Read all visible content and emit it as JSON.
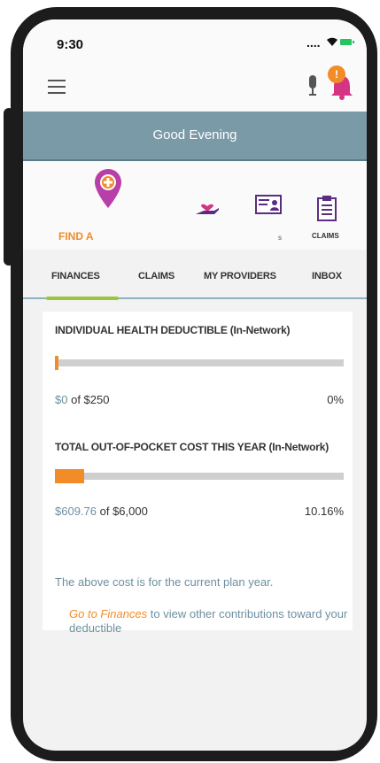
{
  "status_bar": {
    "time": "9:30",
    "signal": "....",
    "icons": [
      "wifi-icon",
      "battery-icon"
    ]
  },
  "header": {
    "menu_icon": "hamburger-icon",
    "mic_icon": "microphone-icon",
    "bell_icon": "bell-icon",
    "notification_badge": "!"
  },
  "greeting": "Good Evening",
  "quick_actions": [
    {
      "label": "FIND A",
      "icon": "location-pin-plus-icon"
    },
    {
      "label": "",
      "icon": "hand-heart-icon"
    },
    {
      "label": "s",
      "icon": "id-card-icon"
    },
    {
      "label": "CLAIMS",
      "icon": "clipboard-icon"
    }
  ],
  "tabs": [
    {
      "label": "FINANCES",
      "active": true
    },
    {
      "label": "CLAIMS",
      "active": false
    },
    {
      "label": "MY PROVIDERS",
      "active": false
    },
    {
      "label": "INBOX",
      "active": false
    }
  ],
  "deductible": {
    "title": "INDIVIDUAL HEALTH DEDUCTIBLE (In-Network)",
    "amount": "$0",
    "of_text": "of $250",
    "percent": "0%",
    "progress": 0
  },
  "out_of_pocket": {
    "title": "TOTAL OUT-OF-POCKET COST THIS YEAR (In-Network)",
    "amount": "$609.76",
    "of_text": "of $6,000",
    "percent": "10.16%",
    "progress": 0.1016
  },
  "plan_note": "The above cost is for the current plan year.",
  "finances_link": {
    "link_text": "Go to Finances",
    "rest_text": "to view other contributions toward your deductible"
  },
  "colors": {
    "accent": "#f28c28",
    "greeting_bg": "#7a9aa8",
    "tab_active": "#9ac73b",
    "find_icon": "#b83fa8"
  }
}
